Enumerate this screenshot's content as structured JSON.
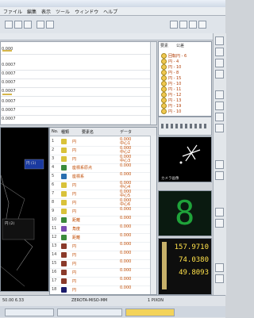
{
  "menu": [
    "ファイル",
    "編集",
    "表示",
    "ツール",
    "ウィンドウ",
    "ヘルプ"
  ],
  "list_rows": [
    "0.000",
    "0.0007",
    "0.0007",
    "0.0007",
    "0.0007",
    "0.0007",
    "0.0007",
    "0.0007",
    "0.0007"
  ],
  "tree": {
    "tabs": [
      "要素",
      "公差"
    ],
    "items": [
      "回転円 - 6",
      "円 - 4",
      "円 - 10",
      "円 - 8",
      "円 - 15",
      "円 - 10",
      "円 - 11",
      "円 - 12",
      "円 - 13",
      "円 - 19",
      "円 - 10",
      "円 - 60"
    ]
  },
  "grid": {
    "headers": [
      "No.",
      "種類",
      "要素名",
      "データ"
    ],
    "rows": [
      {
        "idx": "1",
        "name": "円",
        "val1": "0.000",
        "val2": "中心1",
        "color": "#d9c23a"
      },
      {
        "idx": "2",
        "name": "円",
        "val1": "0.000",
        "val2": "中心2",
        "color": "#d9c23a"
      },
      {
        "idx": "3",
        "name": "円",
        "val1": "0.000",
        "val2": "中心3",
        "color": "#d9c23a"
      },
      {
        "idx": "4",
        "name": "座標系原点",
        "val1": "0.000",
        "val2": "",
        "color": "#3a8a3a"
      },
      {
        "idx": "5",
        "name": "座標系",
        "val1": "0.000",
        "val2": "",
        "color": "#2a6fb0"
      },
      {
        "idx": "6",
        "name": "円",
        "val1": "0.000",
        "val2": "中心4",
        "color": "#d9c23a"
      },
      {
        "idx": "7",
        "name": "円",
        "val1": "0.000",
        "val2": "中心5",
        "color": "#d9c23a"
      },
      {
        "idx": "8",
        "name": "円",
        "val1": "0.000",
        "val2": "中心6",
        "color": "#d9c23a"
      },
      {
        "idx": "9",
        "name": "円",
        "val1": "0.000",
        "val2": "",
        "color": "#d9c23a"
      },
      {
        "idx": "10",
        "name": "距離",
        "val1": "0.000",
        "val2": "",
        "color": "#3a8a3a"
      },
      {
        "idx": "11",
        "name": "角度",
        "val1": "0.000",
        "val2": "",
        "color": "#7a4ab0"
      },
      {
        "idx": "12",
        "name": "距離",
        "val1": "0.000",
        "val2": "",
        "color": "#3a8a3a"
      },
      {
        "idx": "13",
        "name": "円",
        "val1": "0.000",
        "val2": "",
        "color": "#8a3a2a"
      },
      {
        "idx": "14",
        "name": "円",
        "val1": "0.000",
        "val2": "",
        "color": "#8a3a2a"
      },
      {
        "idx": "15",
        "name": "円",
        "val1": "0.000",
        "val2": "",
        "color": "#8a3a2a"
      },
      {
        "idx": "16",
        "name": "円",
        "val1": "0.000",
        "val2": "",
        "color": "#8a3a2a"
      },
      {
        "idx": "17",
        "name": "円",
        "val1": "0.000",
        "val2": "",
        "color": "#8a3a2a"
      },
      {
        "idx": "18",
        "name": "円",
        "val1": "0.000",
        "val2": "",
        "color": "#1a1a6a"
      }
    ]
  },
  "viewport": {
    "label1": "円 (1)",
    "label2": "円 (2)"
  },
  "star_caption": "カメラ画像",
  "digit": "8",
  "coords": [
    "157.9710",
    "74.0380",
    "49.8093"
  ],
  "status": {
    "left": "50.00 6.33",
    "mid": "ZEROTA-MISO-MM",
    "right": "1 PIXON"
  }
}
